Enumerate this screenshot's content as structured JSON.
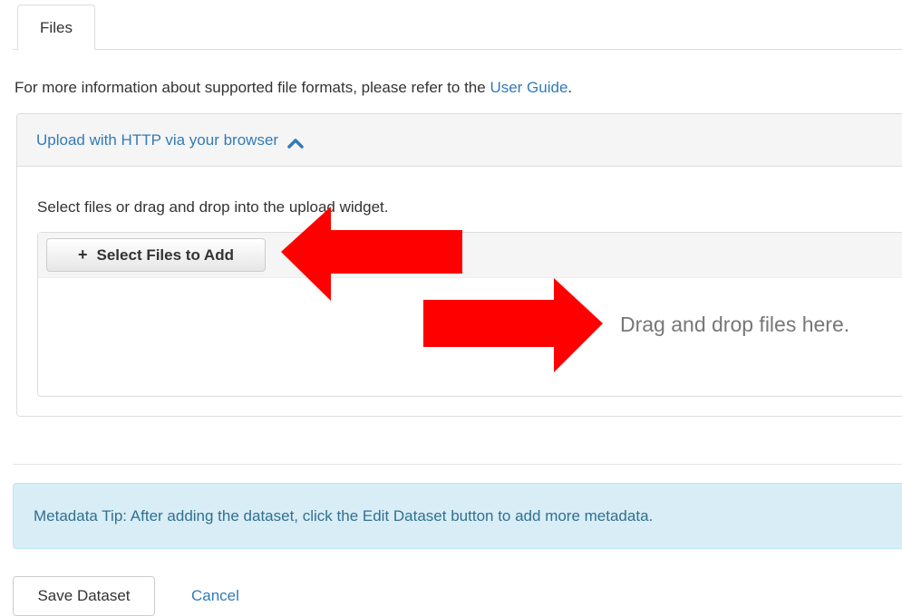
{
  "tabs": [
    {
      "label": "Files"
    }
  ],
  "info": {
    "text": "For more information about supported file formats, please refer to the ",
    "link": "User Guide",
    "suffix": "."
  },
  "upload_panel": {
    "heading": "Upload with HTTP via your browser",
    "chevron_icon": "chevron-up-icon",
    "instructions": "Select files or drag and drop into the upload widget.",
    "select_button": "Select Files to Add",
    "select_icon": "plus-icon",
    "drop_text": "Drag and drop files here."
  },
  "annotations": {
    "arrow_color": "#ff0000"
  },
  "alert": {
    "text": "Metadata Tip: After adding the dataset, click the Edit Dataset button to add more metadata."
  },
  "footer": {
    "save_label": "Save Dataset",
    "cancel_label": "Cancel"
  },
  "colors": {
    "link": "#337ab7",
    "alert_bg": "#d9edf7",
    "alert_text": "#31708f"
  }
}
